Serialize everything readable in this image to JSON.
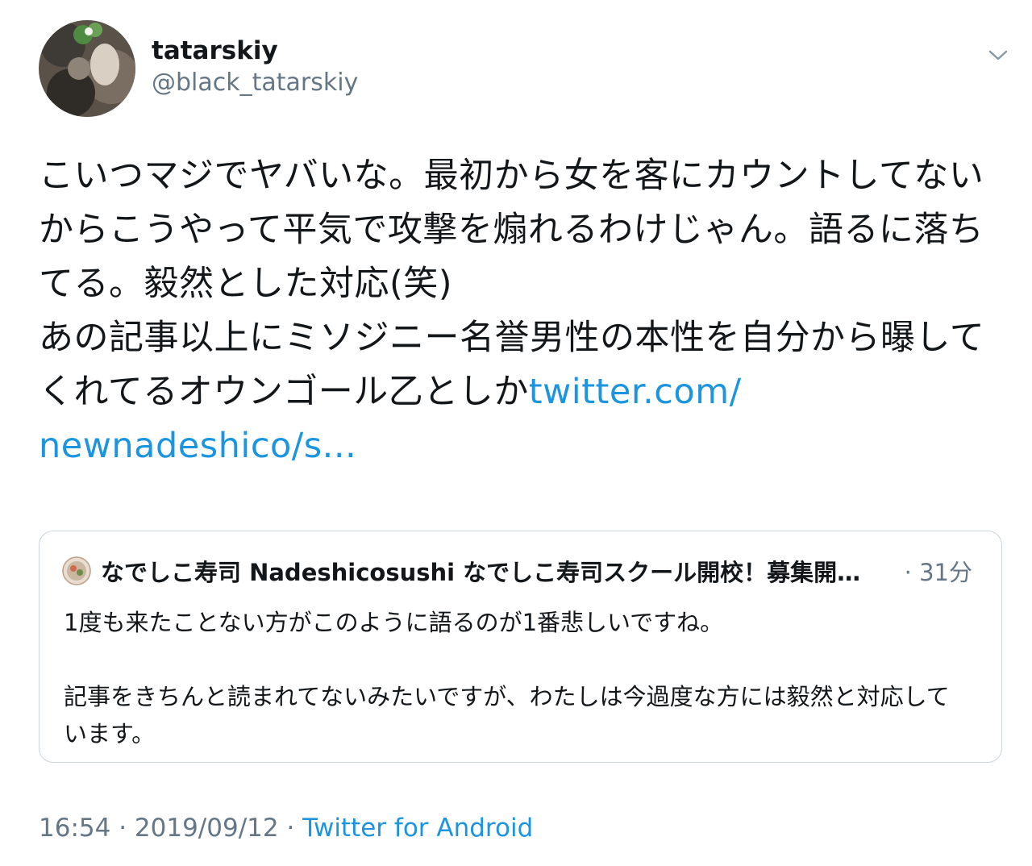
{
  "author": {
    "display_name": "tatarskiy",
    "handle": "@black_tatarskiy"
  },
  "tweet": {
    "text": "こいつマジでヤバいな。最初から女を客にカウントしてないからこうやって平気で攻撃を煽れるわけじゃん。語るに落ちてる。毅然とした対応(笑)\nあの記事以上にミソジニー名誉男性の本性を自分から曝してくれてるオウンゴール乙としか",
    "link_text": "twitter.com/\nnewnadeshico/s..."
  },
  "quoted_tweet": {
    "header": "なでしこ寿司  Nadeshicosushi  なでしこ寿司スクール開校！募集開…",
    "time": "· 31分",
    "text": "1度も来たことない方がこのように語るのが1番悲しいですね。\n\n記事をきちんと読まれてないみたいですが、わたしは今過度な方には毅然と対応しています。"
  },
  "meta": {
    "time": "16:54",
    "separator": " · ",
    "date": "2019/09/12",
    "source": "Twitter for Android"
  },
  "icons": {
    "menu": "chevron-down-icon",
    "avatar": "user-avatar",
    "quote_avatar": "quoted-user-avatar"
  },
  "colors": {
    "link": "#1b95e0",
    "secondary_text": "#657786",
    "border": "#ccd6dd"
  }
}
